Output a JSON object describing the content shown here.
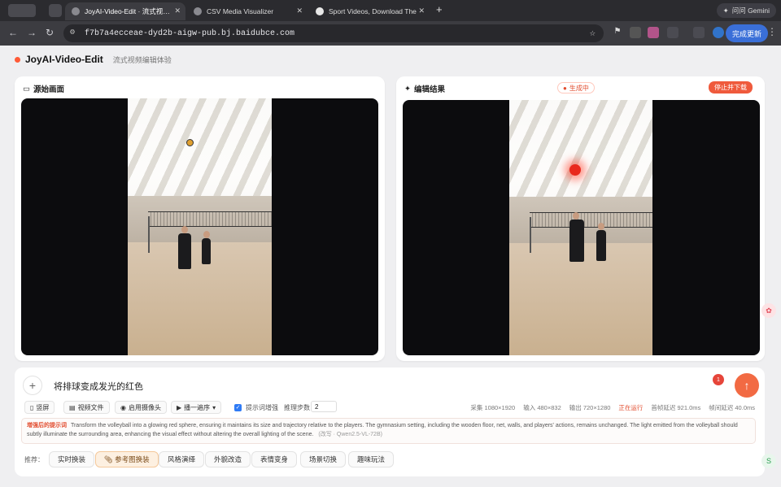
{
  "browser": {
    "tabs": [
      {
        "label": "JoyAI-Video-Edit · 流式视频编"
      },
      {
        "label": "CSV Media Visualizer"
      },
      {
        "label": "Sport Videos, Download The"
      }
    ],
    "gemini_label": "问问 Gemini",
    "url": "f7b7a4ecceae-dyd2b-aigw-pub.bj.baidubce.com",
    "update_label": "完成更新"
  },
  "app": {
    "title": "JoyAI-Video-Edit",
    "subtitle": "流式视频编辑体验"
  },
  "source_panel": {
    "title": "源始画面"
  },
  "result_panel": {
    "title": "编辑结果",
    "status": "生成中",
    "stop_label": "停止并下载"
  },
  "composer": {
    "prompt": "将排球变成发光的红色",
    "notif_count": "1",
    "chips": [
      "竖屏",
      "视频文件",
      "启用摄像头",
      "播一遍序"
    ],
    "checkbox_label": "提示词增强",
    "steps_label": "推理步数",
    "steps_value": "2",
    "stats": [
      {
        "label": "采集",
        "value": "1080×1920"
      },
      {
        "label": "输入",
        "value": "480×832"
      },
      {
        "label": "输出",
        "value": "720×1280"
      },
      {
        "label": "",
        "value": "正在运行"
      },
      {
        "label": "首帧延迟",
        "value": "921.0ms"
      },
      {
        "label": "帧间延迟",
        "value": "40.0ms"
      }
    ],
    "enhanced_label": "增强后的提示词",
    "enhanced_text": "Transform the volleyball into a glowing red sphere, ensuring it maintains its size and trajectory relative to the players. The gymnasium setting, including the wooden floor, net, walls, and players' actions, remains unchanged. The light emitted from the volleyball should subtly illuminate the surrounding area, enhancing the visual effect without altering the overall lighting of the scene.",
    "enhanced_model": "(改写 · Qwen2.5-VL-72B)",
    "rec_label": "推荐：",
    "recommendations": [
      "实时换装",
      "参考图换装",
      "风格演绎",
      "外貌改造",
      "表情变身",
      "场景切换",
      "趣味玩法"
    ],
    "selected_rec": 1
  },
  "colors": {
    "accent": "#ef5a3c",
    "checkbox": "#2f7bf5",
    "selected_chip": "#fdf0e1"
  }
}
